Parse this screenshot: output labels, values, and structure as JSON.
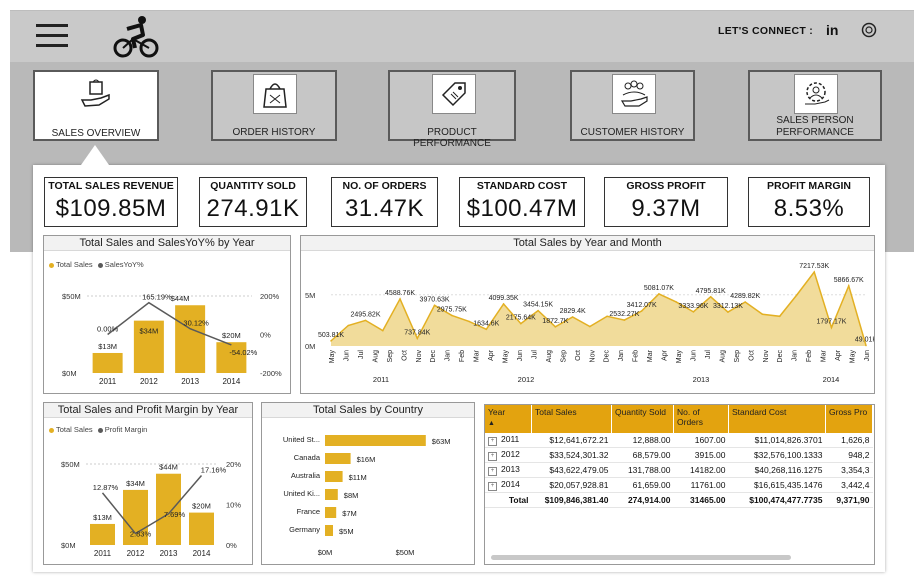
{
  "header": {
    "connect_label": "LET'S CONNECT :",
    "icons": [
      "hamburger-icon",
      "cyclist-icon",
      "linkedin-icon",
      "github-icon"
    ]
  },
  "nav": [
    {
      "label": "SALES OVERVIEW",
      "icon": "bag-hand-icon",
      "active": true
    },
    {
      "label": "ORDER HISTORY",
      "icon": "shopping-bag-icon",
      "active": false
    },
    {
      "label": "PRODUCT PERFORMANCE",
      "icon": "price-tag-icon",
      "active": false
    },
    {
      "label": "CUSTOMER HISTORY",
      "icon": "people-hand-icon",
      "active": false
    },
    {
      "label": "SALES PERSON PERFORMANCE",
      "icon": "person-gear-icon",
      "active": false
    }
  ],
  "kpis": [
    {
      "title": "TOTAL SALES REVENUE",
      "value": "$109.85M"
    },
    {
      "title": "QUANTITY SOLD",
      "value": "274.91K"
    },
    {
      "title": "NO. OF ORDERS",
      "value": "31.47K"
    },
    {
      "title": "STANDARD COST",
      "value": "$100.47M"
    },
    {
      "title": "GROSS PROFIT",
      "value": "9.37M"
    },
    {
      "title": "PROFIT MARGIN",
      "value": "8.53%"
    }
  ],
  "colors": {
    "accent": "#e3b023",
    "line": "#5a5a5a",
    "header": "#c9c9c9"
  },
  "chart_data": [
    {
      "type": "bar",
      "title": "Total Sales and SalesYoY% by Year",
      "legend": [
        "Total Sales",
        "SalesYoY%"
      ],
      "categories": [
        "2011",
        "2012",
        "2013",
        "2014"
      ],
      "series": [
        {
          "name": "Total Sales",
          "values": [
            13,
            34,
            44,
            20
          ],
          "labels": [
            "$13M",
            "$34M",
            "$44M",
            "$20M"
          ]
        },
        {
          "name": "SalesYoY%",
          "values": [
            0.0,
            165.19,
            30.12,
            -54.02
          ],
          "labels": [
            "0.00%",
            "165.19%",
            "30.12%",
            "-54.02%"
          ]
        }
      ],
      "left_ticks": [
        "$50M",
        "$0M"
      ],
      "right_ticks": [
        "200%",
        "0%",
        "-200%"
      ],
      "ylim": [
        0,
        50
      ],
      "y2lim": [
        -200,
        200
      ]
    },
    {
      "type": "area",
      "title": "Total Sales by Year and Month",
      "y_ticks": [
        "5M",
        "0M"
      ],
      "ylim": [
        0,
        8
      ],
      "months": [
        "May",
        "Jun",
        "Jul",
        "Aug",
        "Sep",
        "Oct",
        "Nov",
        "Dec",
        "Jan",
        "Feb",
        "Mar",
        "Apr",
        "May",
        "Jun",
        "Jul",
        "Aug",
        "Sep",
        "Oct",
        "Nov",
        "Dec",
        "Jan",
        "Feb",
        "Mar",
        "Apr",
        "May",
        "Jun",
        "Jul",
        "Aug",
        "Sep",
        "Oct",
        "Nov",
        "Dec",
        "Jan",
        "Feb",
        "Mar",
        "Apr",
        "May",
        "Jun"
      ],
      "values": [
        0.5,
        2.0,
        2.5,
        1.5,
        4.59,
        0.74,
        3.97,
        2.98,
        2.4,
        1.63,
        4.1,
        2.18,
        3.45,
        1.87,
        2.83,
        1.9,
        2.9,
        2.53,
        3.41,
        5.08,
        4.3,
        3.33,
        4.8,
        3.31,
        4.29,
        3.1,
        2.9,
        5.0,
        7.22,
        1.8,
        5.87,
        0.05
      ],
      "labels": [
        "503.81K",
        "",
        "2495.82K",
        "",
        "4588.76K",
        "737.84K",
        "3970.63K",
        "2975.75K",
        "",
        "1634.6K",
        "4099.35K",
        "2175.64K",
        "3454.15K",
        "1872.7K",
        "2829.4K",
        "",
        "",
        "2532.27K",
        "3412.07K",
        "5081.07K",
        "",
        "3333.96K",
        "4795.81K",
        "3312.13K",
        "4289.82K",
        "",
        "",
        "",
        "7217.53K",
        "1797.17K",
        "5866.67K",
        "49.01K"
      ],
      "year_labels": [
        "2011",
        "2012",
        "2013",
        "2014"
      ]
    },
    {
      "type": "bar",
      "title": "Total Sales and Profit Margin by Year",
      "legend": [
        "Total Sales",
        "Profit Margin"
      ],
      "categories": [
        "2011",
        "2012",
        "2013",
        "2014"
      ],
      "series": [
        {
          "name": "Total Sales",
          "values": [
            13,
            34,
            44,
            20
          ],
          "labels": [
            "$13M",
            "$34M",
            "$44M",
            "$20M"
          ]
        },
        {
          "name": "Profit Margin",
          "values": [
            12.87,
            2.83,
            7.69,
            17.16
          ],
          "labels": [
            "12.87%",
            "2.83%",
            "7.69%",
            "17.16%"
          ]
        }
      ],
      "left_ticks": [
        "$50M",
        "$0M"
      ],
      "right_ticks": [
        "20%",
        "10%",
        "0%"
      ],
      "ylim": [
        0,
        50
      ],
      "y2lim": [
        0,
        20
      ]
    },
    {
      "type": "bar",
      "orientation": "horizontal",
      "title": "Total Sales by Country",
      "categories": [
        "United St...",
        "Canada",
        "Australia",
        "United Ki...",
        "France",
        "Germany"
      ],
      "values": [
        63,
        16,
        11,
        8,
        7,
        5
      ],
      "labels": [
        "$63M",
        "$16M",
        "$11M",
        "$8M",
        "$7M",
        "$5M"
      ],
      "x_ticks": [
        "$0M",
        "$50M"
      ],
      "xlim": [
        0,
        70
      ]
    }
  ],
  "table": {
    "columns": [
      "Year",
      "Total Sales",
      "Quantity Sold",
      "No. of Orders",
      "Standard Cost",
      "Gross Pro"
    ],
    "rows": [
      [
        "2011",
        "$12,641,672.21",
        "12,888.00",
        "1607.00",
        "$11,014,826.3701",
        "1,626,8"
      ],
      [
        "2012",
        "$33,524,301.32",
        "68,579.00",
        "3915.00",
        "$32,576,100.1333",
        "948,2"
      ],
      [
        "2013",
        "$43,622,479.05",
        "131,788.00",
        "14182.00",
        "$40,268,116.1275",
        "3,354,3"
      ],
      [
        "2014",
        "$20,057,928.81",
        "61,659.00",
        "11761.00",
        "$16,615,435.1476",
        "3,442,4"
      ]
    ],
    "total": [
      "Total",
      "$109,846,381.40",
      "274,914.00",
      "31465.00",
      "$100,474,477.7735",
      "9,371,90"
    ]
  }
}
